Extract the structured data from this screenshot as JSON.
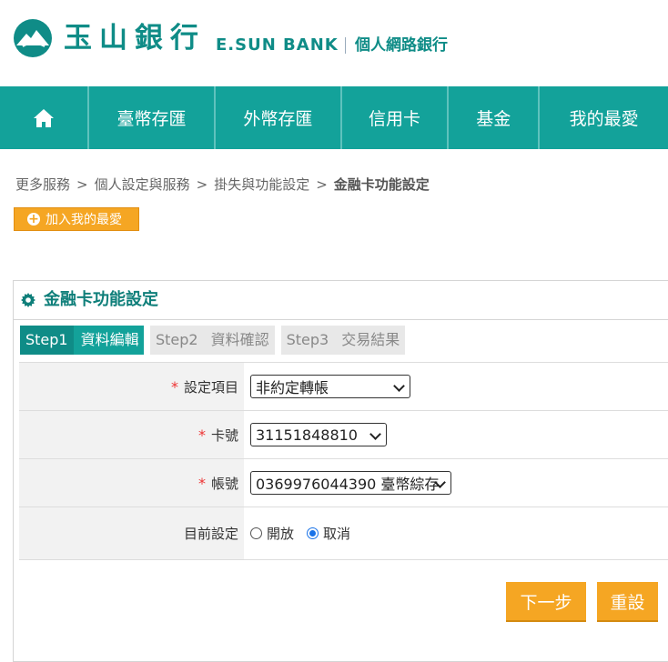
{
  "header": {
    "bank_name_cn": "玉山銀行",
    "bank_name_en": "E.SUN BANK",
    "subtitle": "個人網路銀行",
    "logo_icon": "esun-mountain-logo-icon",
    "brand_color": "#0f8c87"
  },
  "nav": {
    "home_icon": "home-icon",
    "items": [
      "臺幣存匯",
      "外幣存匯",
      "信用卡",
      "基金",
      "我的最愛"
    ],
    "background": "#13a29a"
  },
  "breadcrumb": {
    "items": [
      "更多服務",
      "個人設定與服務",
      "掛失與功能設定"
    ],
    "current": "金融卡功能設定",
    "separator": ">"
  },
  "favorite_button": {
    "label": "加入我的最愛",
    "icon": "plus-circle-icon"
  },
  "panel": {
    "icon": "gear-icon",
    "title": "金融卡功能設定"
  },
  "steps": [
    {
      "num": "Step1",
      "label": "資料編輯",
      "active": true
    },
    {
      "num": "Step2",
      "label": "資料確認",
      "active": false
    },
    {
      "num": "Step3",
      "label": "交易結果",
      "active": false
    }
  ],
  "form": {
    "setting_item": {
      "label": "設定項目",
      "value": "非約定轉帳"
    },
    "card_number": {
      "label": "卡號",
      "value": "31151848810"
    },
    "account": {
      "label": "帳號",
      "value": "0369976044390 臺幣綜存"
    },
    "current_setting": {
      "label": "目前設定",
      "options": [
        "開放",
        "取消"
      ],
      "selected": "取消"
    },
    "required_mark": "*"
  },
  "buttons": {
    "next": "下一步",
    "reset": "重設"
  },
  "accent_orange": "#f5a623"
}
